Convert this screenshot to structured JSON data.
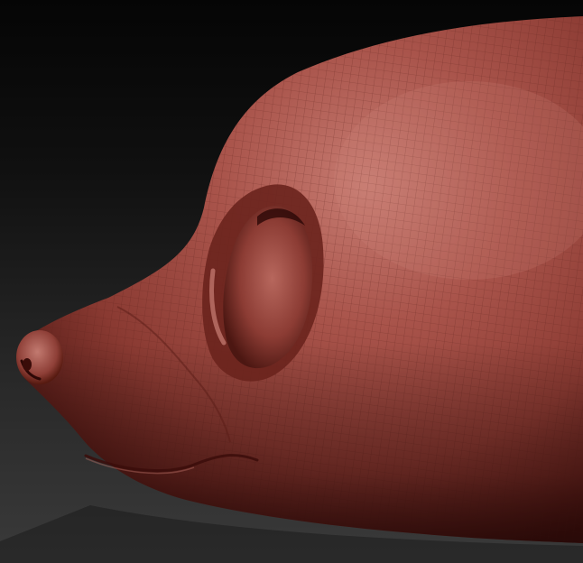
{
  "scene": {
    "subject": "",
    "background_top_color": "#050505",
    "background_bottom_color": "#3a3a3a",
    "material_base_color": "#a5483f",
    "material_highlight_color": "#d0837a",
    "material_shadow_color": "#3a0d0b",
    "wire_color": "#5a1e19"
  }
}
